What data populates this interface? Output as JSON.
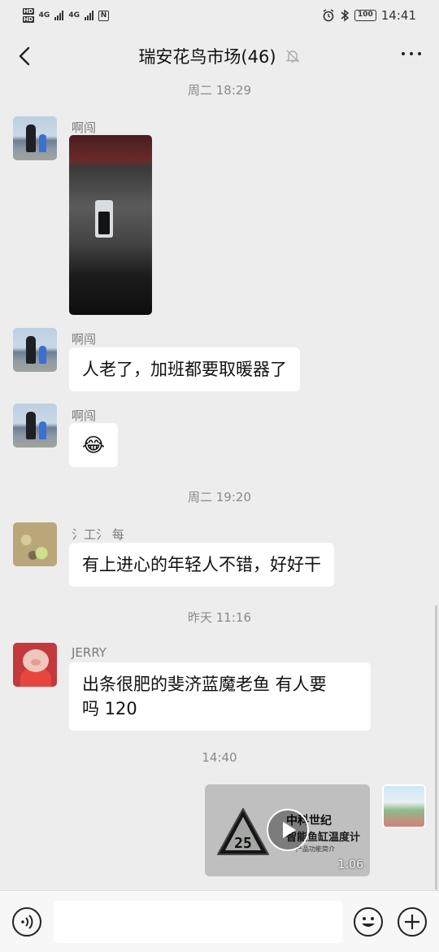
{
  "status_bar": {
    "sim1": "HD",
    "sim2": "HD",
    "net1": "4G",
    "net2": "4G",
    "nfc": "N",
    "battery": "100",
    "time": "14:41"
  },
  "header": {
    "title": "瑞安花鸟市场(46)"
  },
  "messages": [
    {
      "timestamp": "周二 18:29"
    },
    {
      "sender": "啊闯"
    },
    {
      "sender": "啊闯",
      "text": "人老了，加班都要取暖器了"
    },
    {
      "sender": "啊闯",
      "emoji": "😂"
    },
    {
      "timestamp": "周二 19:20"
    },
    {
      "sender": "氵工氵 每",
      "text": "有上进心的年轻人不错，好好干"
    },
    {
      "timestamp": "昨天 11:16"
    },
    {
      "sender": "JERRY",
      "text_line1": "出条很肥的斐济蓝魔老鱼 有人要",
      "text_line2": "吗 120"
    },
    {
      "timestamp": "14:40"
    },
    {
      "video": {
        "title1": "中科世纪",
        "title2": "智能鱼缸温度计",
        "caption": "产品功能简介",
        "reading": "25",
        "duration": "1:06"
      }
    }
  ],
  "icons": {
    "back": "back-arrow-icon",
    "mute": "mute-bell-icon",
    "more": "more-dots-icon",
    "voice": "voice-icon",
    "emoji": "emoji-icon",
    "plus": "plus-icon"
  }
}
